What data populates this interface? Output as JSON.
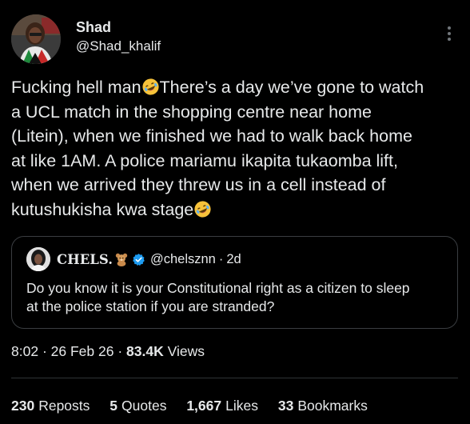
{
  "post": {
    "author_name": "Shad",
    "author_handle": "@Shad_khalif",
    "text": "Fucking hell man🤣There’s a day we’ve gone to watch\na UCL match in the shopping centre near home\n(Litein), when we finished we had to walk back home\nat like 1AM. A police mariamu ikapita tukaomba lift,\nwhen we arrived they threw us in a cell instead of\nkutushukisha kwa stage🤣",
    "text_parts": [
      "Fucking hell man",
      "There’s a day we’ve gone to watch\na UCL match in the shopping centre near home\n(Litein), when we finished we had to walk back home\nat like 1AM. A police mariamu ikapita tukaomba lift,\nwhen we arrived they threw us in a cell instead of\nkutushukisha kwa stage"
    ],
    "emoji_icon": "rolling-on-floor-laughing-emoji",
    "more_icon": "more-vertical-icon"
  },
  "quote": {
    "author_name": "CHELS.",
    "name_emoji": "teddy-bear-emoji",
    "verified_icon": "verified-badge-icon",
    "author_handle": "@chelsznn",
    "dot": "·",
    "time": "2d",
    "text": "Do you know it is your Constitutional right as a citizen to sleep\nat the police station if you are stranded?"
  },
  "meta": {
    "time": "8:02",
    "dot": "·",
    "date": "26 Feb 26",
    "views_count": "83.4K",
    "views_label": "Views"
  },
  "stats": {
    "reposts_count": "230",
    "reposts_label": "Reposts",
    "quotes_count": "5",
    "quotes_label": "Quotes",
    "likes_count": "1,667",
    "likes_label": "Likes",
    "bookmarks_count": "33",
    "bookmarks_label": "Bookmarks"
  },
  "colors": {
    "background": "#000000",
    "text": "#e7e9ea",
    "border": "#3a3d41",
    "verified": "#1d9bf0",
    "emoji": "#f7c23a"
  }
}
